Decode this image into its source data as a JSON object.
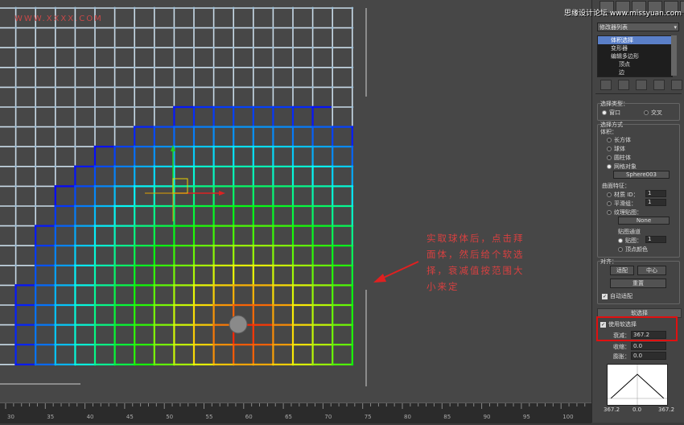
{
  "watermark": "WWW.XXXX.COM",
  "site": "思缘设计论坛 www.missyuan.com",
  "annotation": "实取球体后，点击拜面体，然后给个软选择，衰减值按范围大小来定",
  "panel": {
    "modifier_list": "修改器列表",
    "stack": [
      {
        "label": "体积选择"
      },
      {
        "label": "变形器"
      },
      {
        "label": "编辑多边形"
      },
      {
        "label": "顶点"
      },
      {
        "label": "边"
      }
    ],
    "selection_type": {
      "title": "选择类型：",
      "window": "窗口",
      "crossing": "交叉"
    },
    "selection_method": {
      "title": "选择方式",
      "volume": "体积：",
      "box": "长方体",
      "sphere": "球体",
      "cylinder": "圆柱体",
      "mesh_object": "网格对象",
      "object_name": "Sphere003"
    },
    "surface": {
      "title": "曲面特征：",
      "material_id": "材质 ID：",
      "smoothing": "平滑组：",
      "texture_map": "纹理贴图：",
      "material_id_value": "1",
      "smoothing_value": "1",
      "map_value": "1",
      "none": "None",
      "map_channel": "贴图通道",
      "map": "贴图：",
      "vertex_color": "顶点颜色"
    },
    "align": {
      "title": "对齐：",
      "fit": "适配",
      "center": "中心",
      "reset": "重置",
      "auto_fit": "自动适配"
    },
    "soft_selection": {
      "title": "软选择",
      "use_soft": "使用软选择",
      "falloff": "衰减：",
      "falloff_value": "367.2",
      "pinch": "收缩：",
      "pinch_value": "0.0",
      "bubble": "膨胀：",
      "bubble_value": "0.0",
      "curve_left": "367.2",
      "curve_mid": "0.0",
      "curve_right": "367.2"
    }
  },
  "ruler": {
    "ticks": [
      "30",
      "35",
      "40",
      "45",
      "50",
      "55",
      "60",
      "65",
      "70",
      "75",
      "80",
      "85",
      "90",
      "95",
      "100"
    ]
  },
  "colors": {
    "accent": "#5a7fc8",
    "annotation": "#d84040",
    "highlight_box": "#e01010"
  }
}
